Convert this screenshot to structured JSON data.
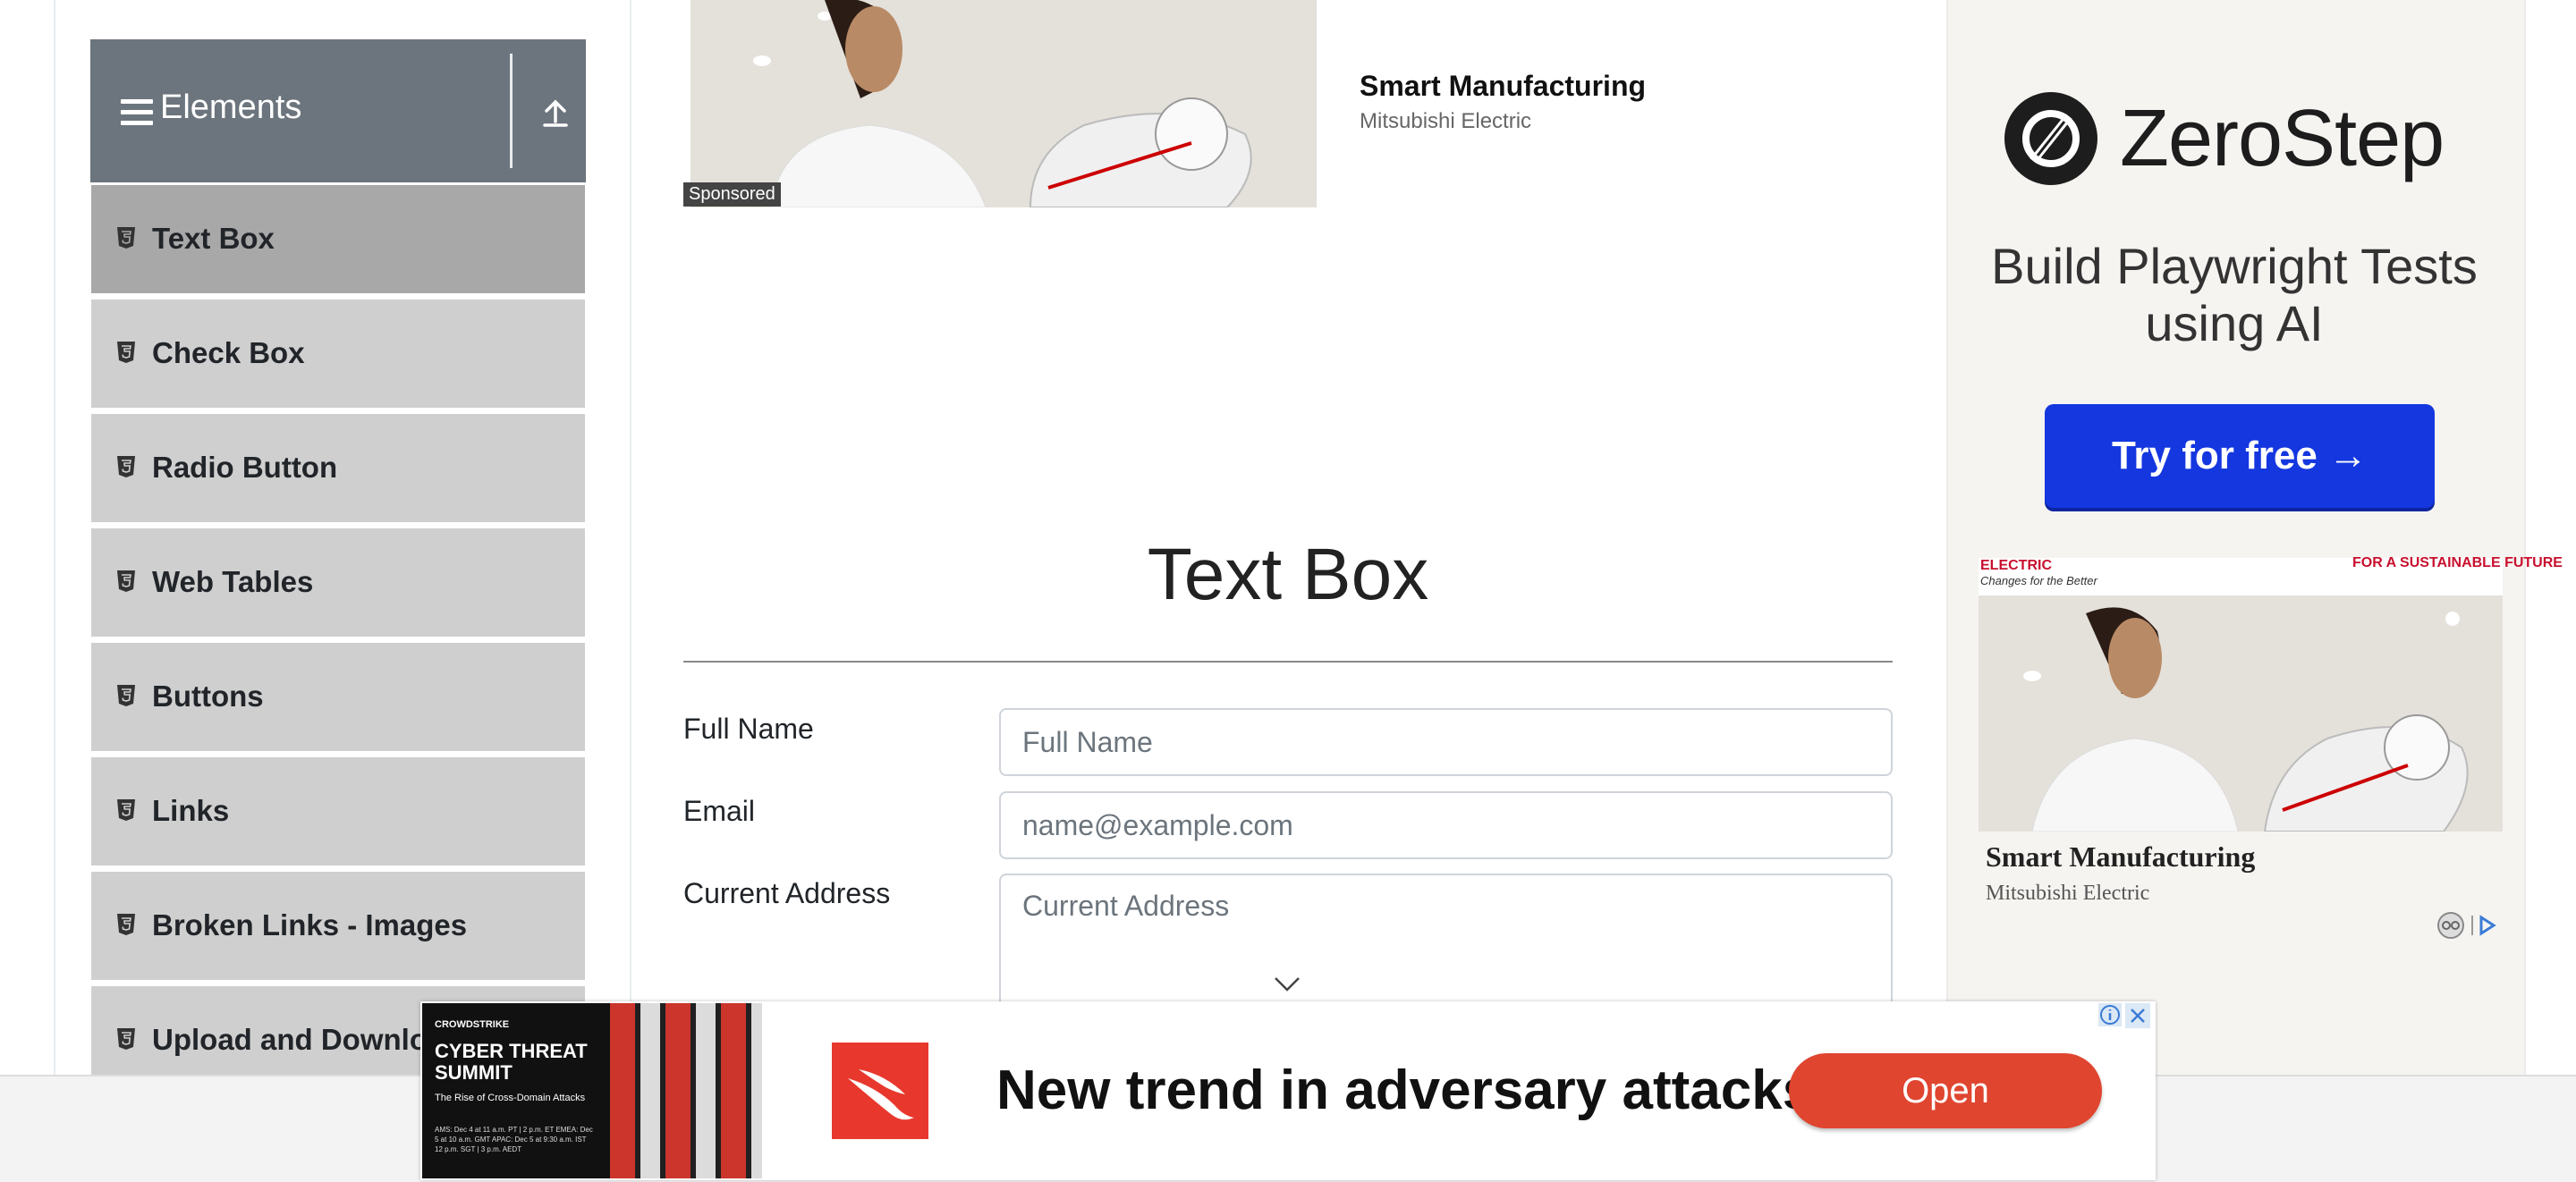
{
  "sidebar": {
    "header_title": "Elements",
    "items": [
      {
        "label": "Text Box",
        "active": true
      },
      {
        "label": "Check Box"
      },
      {
        "label": "Radio Button"
      },
      {
        "label": "Web Tables"
      },
      {
        "label": "Buttons"
      },
      {
        "label": "Links"
      },
      {
        "label": "Broken Links - Images"
      },
      {
        "label": "Upload and Downlo"
      }
    ]
  },
  "top_ad": {
    "sponsored_label": "Sponsored",
    "title": "Smart Manufacturing",
    "subtitle": "Mitsubishi Electric"
  },
  "main": {
    "title": "Text Box",
    "fields": {
      "full_name_label": "Full Name",
      "full_name_placeholder": "Full Name",
      "email_label": "Email",
      "email_placeholder": "name@example.com",
      "address_label": "Current Address",
      "address_placeholder": "Current Address"
    }
  },
  "right_ad": {
    "brand": "ZeroStep",
    "headline": "Build Playwright Tests using AI",
    "cta": "Try for free →",
    "cta_color": "#1437e0",
    "ad2_brand": "ELECTRIC",
    "ad2_tagline": "Changes for the Better",
    "ad2_corner": "FOR A SUSTAINABLE FUTURE",
    "ad2_title": "Smart Manufacturing",
    "ad2_subtitle": "Mitsubishi Electric"
  },
  "bottom_ad": {
    "sponsor": "CROWDSTRIKE",
    "event_title": "CYBER THREAT SUMMIT",
    "event_sub": "The Rise of Cross-Domain Attacks",
    "event_dates": "AMS: Dec 4 at 11 a.m. PT | 2 p.m. ET  EMEA: Dec 5 at 10 a.m. GMT  APAC: Dec 5 at 9:30 a.m. IST 12 p.m. SGT | 3 p.m. AEDT",
    "headline": "New trend in adversary attacks",
    "cta": "Open",
    "cta_color": "#e0452f"
  }
}
